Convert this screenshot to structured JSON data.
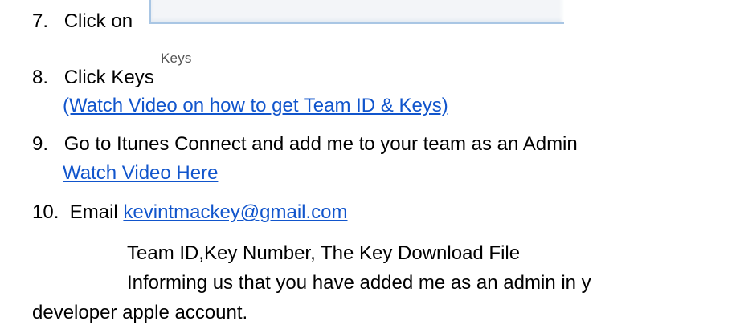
{
  "steps": [
    {
      "number": "7.",
      "text": "Click on"
    },
    {
      "number": "8.",
      "text": "Click Keys"
    },
    {
      "link": "(Watch Video on how to get Team ID & Keys)"
    },
    {
      "number": "9.",
      "text": "Go to Itunes Connect and add me to your team as an Admin"
    },
    {
      "link": "Watch Video Here"
    },
    {
      "number": "10.",
      "text": " Email ",
      "link": "kevintmackey@gmail.com"
    }
  ],
  "details": [
    "Team ID,Key Number, The Key Download File",
    "Informing us that you have added me as an admin in y",
    "developer apple account."
  ],
  "screenshot": {
    "keys_label": "Keys"
  },
  "colors": {
    "link": "#1155cc",
    "text": "#000000"
  }
}
